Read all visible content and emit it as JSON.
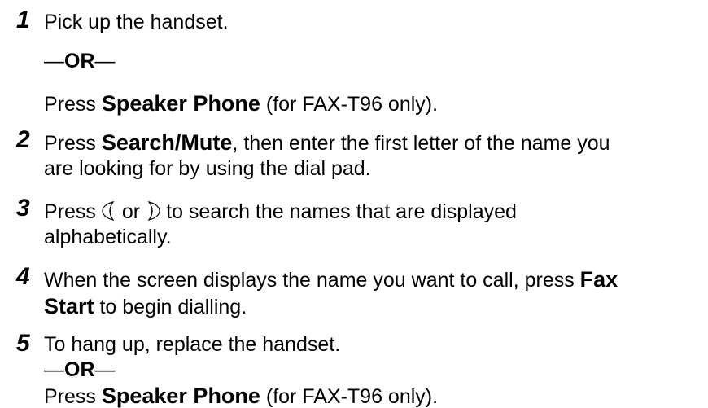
{
  "steps": [
    {
      "number": "1",
      "line1": "Pick up the handset.",
      "or_dash_left": "—",
      "or_word": "OR",
      "or_dash_right": "—",
      "press": "Press ",
      "key": "Speaker Phone",
      "suffix": " (for FAX-T96 only)."
    },
    {
      "number": "2",
      "press": "Press ",
      "key": "Search/Mute",
      "line1_rest": ", then enter the first letter of the name you",
      "line2": "are looking for by using the dial pad."
    },
    {
      "number": "3",
      "press": "Press",
      "or_word": "or",
      "line1_rest": "to search the names that are displayed",
      "line2": "alphabetically.",
      "icons": [
        "left-arrow-key-icon",
        "right-arrow-key-icon"
      ]
    },
    {
      "number": "4",
      "line1_text": "When the screen displays the name you want to call, press ",
      "key_part1": "Fax",
      "key_part2": "Start",
      "line2_rest": " to begin dialling."
    },
    {
      "number": "5",
      "line1": "To hang up, replace the handset.",
      "or_dash_left": "—",
      "or_word": "OR",
      "or_dash_right": "—",
      "press": "Press ",
      "key": "Speaker Phone",
      "suffix": " (for FAX-T96 only)."
    }
  ]
}
